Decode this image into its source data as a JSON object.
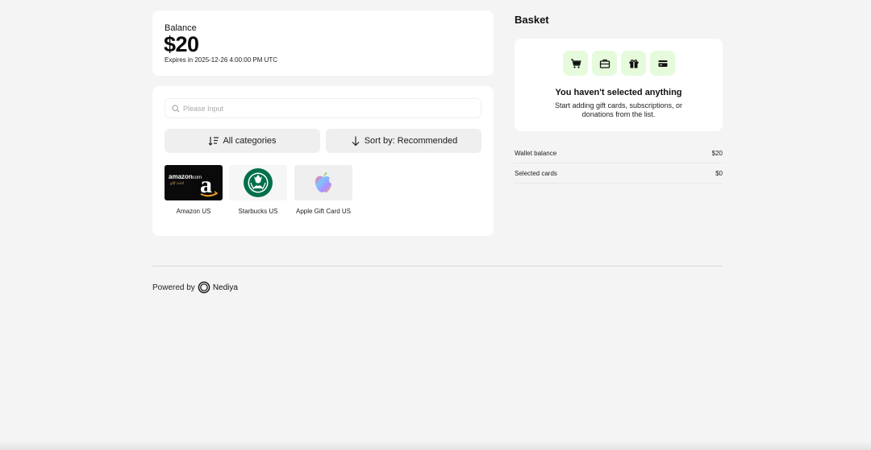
{
  "balance": {
    "label": "Balance",
    "amount": "$20",
    "expiry": "Expires in 2025-12-26 4:00:00 PM UTC"
  },
  "catalog": {
    "search_placeholder": "Please Input",
    "categories_label": "All categories",
    "sort_label": "Sort by: Recommended",
    "products": [
      {
        "name": "Amazon US",
        "icon": "amazon-gift-card-logo"
      },
      {
        "name": "Starbucks US",
        "icon": "starbucks-logo"
      },
      {
        "name": "Apple Gift Card US",
        "icon": "apple-logo"
      }
    ]
  },
  "basket": {
    "title": "Basket",
    "icons": [
      "cart-icon",
      "briefcase-icon",
      "gift-icon",
      "card-icon"
    ],
    "empty_title": "You haven't selected anything",
    "empty_subtitle": "Start adding gift cards, subscriptions, or donations from the list.",
    "summary": [
      {
        "label": "Wallet balance",
        "value": "$20"
      },
      {
        "label": "Selected cards",
        "value": "$0"
      }
    ]
  },
  "footer": {
    "powered_by": "Powered by",
    "brand": "Nediya"
  },
  "colors": {
    "page_bg": "#f4f4f4",
    "card_bg": "#ffffff",
    "accent_tile": "#e6fbdc",
    "starbucks_green": "#00704a",
    "button_bg": "#efefef"
  }
}
